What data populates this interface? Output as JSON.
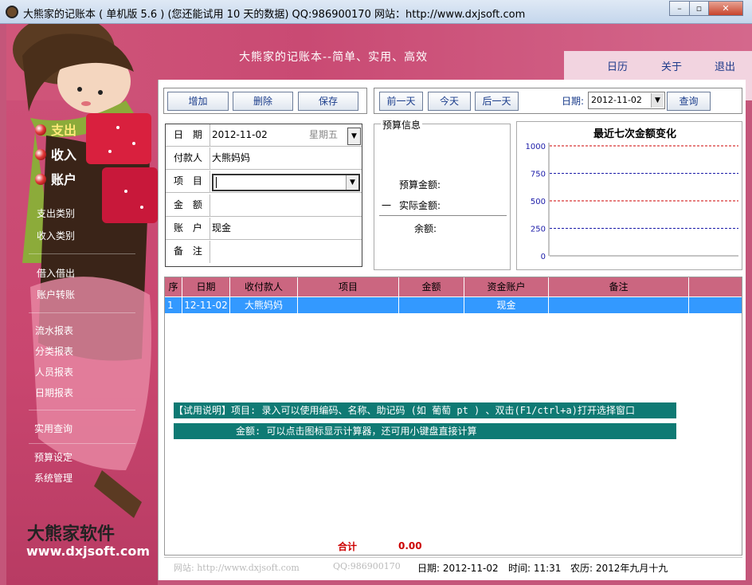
{
  "window": {
    "title": "大熊家的记账本 ( 单机版 5.6 ) (您还能试用 10 天的数据) QQ:986900170 网站：http://www.dxjsoft.com",
    "minimize": "–",
    "maximize": "▫",
    "close": "✕"
  },
  "header": {
    "slogan": "大熊家的记账本--简单、实用、高效",
    "nav": [
      "日历",
      "关于",
      "退出"
    ]
  },
  "sidebar": {
    "main_items": [
      "支出",
      "收入",
      "账户"
    ],
    "groups": [
      [
        "支出类别",
        "收入类别"
      ],
      [
        "借入借出",
        "账户转账"
      ],
      [
        "流水报表",
        "分类报表",
        "人员报表",
        "日期报表"
      ],
      [
        "实用查询"
      ],
      [
        "预算设定",
        "系统管理"
      ]
    ],
    "brand_cn": "大熊家软件",
    "brand_url": "www.dxjsoft.com"
  },
  "toolbar": {
    "add": "增加",
    "delete": "删除",
    "save": "保存",
    "prev_day": "前一天",
    "today": "今天",
    "next_day": "后一天",
    "date_label": "日期:",
    "date_value": "2012-11-02",
    "query": "查询"
  },
  "form": {
    "date_label": "日 期",
    "date_value": "2012-11-02",
    "weekday": "星期五",
    "payer_label": "付款人",
    "payer_value": "大熊妈妈",
    "item_label": "项 目",
    "item_value": "",
    "amount_label": "金 额",
    "amount_value": "",
    "account_label": "账 户",
    "account_value": "现金",
    "note_label": "备 注",
    "note_value": ""
  },
  "budget": {
    "legend": "预算信息",
    "budget_amount": "预算金额:",
    "actual_amount": "实际金额:",
    "minus": "一",
    "balance": "余额:"
  },
  "chart_data": {
    "type": "line",
    "title": "最近七次金额变化",
    "yticks": [
      1000,
      750,
      500,
      250,
      0
    ],
    "ylim": [
      0,
      1000
    ],
    "series": [],
    "grid": true,
    "gridline_colors": [
      "#cc0000",
      "#1a1aa8"
    ]
  },
  "table": {
    "columns": [
      "序",
      "日期",
      "收付款人",
      "项目",
      "金额",
      "资金账户",
      "备注"
    ],
    "rows": [
      [
        "1",
        "12-11-02",
        "大熊妈妈",
        "",
        "",
        "现金",
        ""
      ]
    ],
    "total_label": "合计",
    "total_value": "0.00"
  },
  "tips": [
    "【试用说明】项目: 录入可以使用编码、名称、助记码 (如 葡萄 pt  ) 、双击(F1/ctrl+a)打开选择窗口",
    "金额: 可以点击图标显示计算器，还可用小键盘直接计算"
  ],
  "status": {
    "site": "网站: http://www.dxjsoft.com",
    "qq": "QQ:986900170",
    "date": "日期: 2012-11-02",
    "time": "时间: 11:31",
    "lunar": "农历: 2012年九月十九"
  },
  "colors": {
    "brand": "#c94a73",
    "header_row": "#cb6680",
    "selected_row": "#3399ff",
    "tip_bg": "#0f7a74",
    "total": "#cc0000"
  }
}
